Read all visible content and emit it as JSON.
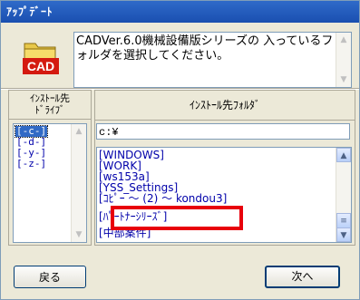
{
  "window": {
    "title": "ｱｯﾌﾟﾃﾞｰﾄ"
  },
  "logo": {
    "text": "CAD",
    "icon": "folder-cad-icon"
  },
  "message": "CADVer.6.0機械設備版シリーズの 入っているフォルダを選択してください。",
  "drives": {
    "header": "ｲﾝｽﾄｰﾙ先\nﾄﾞﾗｲﾌﾞ",
    "items": [
      "[-c-]",
      "[-d-]",
      "[-y-]",
      "[-z-]"
    ],
    "selected": "[-c-]"
  },
  "folders": {
    "header": "ｲﾝｽﾄｰﾙ先ﾌｫﾙﾀﾞ",
    "path": "c:¥",
    "items": [
      "[WINDOWS]",
      "[WORK]",
      "[ws153a]",
      "[YSS_Settings]",
      "[ｺﾋﾟｰ ～ (2) ～ kondou3]",
      "[ﾊﾟｰﾄﾅｰｼﾘｰｽﾞ]",
      "[中部案件]"
    ],
    "highlighted": "[ﾊﾟｰﾄﾅｰｼﾘｰｽﾞ]"
  },
  "buttons": {
    "back": "戻る",
    "next": "次へ"
  },
  "colors": {
    "title_bar": "#1a4fb0",
    "highlight_box": "#e8000b",
    "selection": "#316ac5",
    "list_text": "#0000aa"
  }
}
